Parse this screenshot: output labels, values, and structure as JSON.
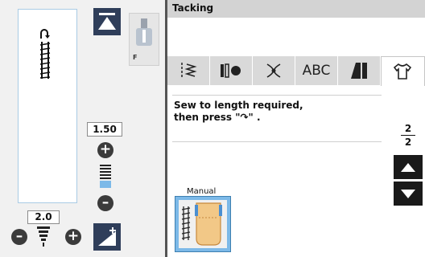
{
  "left_panel": {
    "stitch_length": "1.50",
    "stitch_width": "2.0"
  },
  "header": {
    "title": "Tacking"
  },
  "tabs": [
    {
      "name": "utility-stitch",
      "label": ""
    },
    {
      "name": "buttonhole",
      "label": ""
    },
    {
      "name": "decorative",
      "label": ""
    },
    {
      "name": "alphabet",
      "label": "ABC"
    },
    {
      "name": "satin",
      "label": ""
    },
    {
      "name": "garment",
      "label": ""
    }
  ],
  "message": {
    "line1": "Sew to length required,",
    "line2": "then press \"↷\" ."
  },
  "page_indicator": {
    "current": "2",
    "total": "2"
  },
  "pattern_button": {
    "label": "Manual"
  },
  "presser_foot": {
    "letter": "F"
  },
  "colors": {
    "accent_blue": "#7cb9e8",
    "dark_button": "#1a1a1a"
  }
}
